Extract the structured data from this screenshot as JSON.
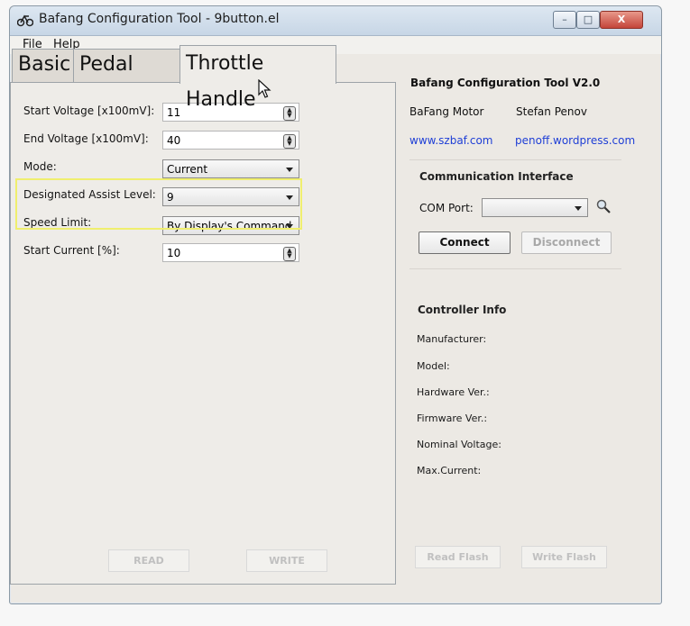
{
  "window": {
    "title": "Bafang Configuration Tool - 9button.el",
    "controls": [
      "–",
      "□",
      "X"
    ]
  },
  "menu": [
    "File",
    "Help"
  ],
  "tabs": [
    {
      "label": "Basic"
    },
    {
      "label": "Pedal Assit"
    },
    {
      "label": "Throttle Handle",
      "selected": true
    }
  ],
  "throttle": {
    "fields": [
      {
        "label": "Start Voltage [x100mV]:",
        "value": "11"
      },
      {
        "label": "End Voltage [x100mV]:",
        "value": "40"
      },
      {
        "label": "Mode:",
        "value": "Current"
      },
      {
        "label": "Designated Assist Level:",
        "value": "9"
      },
      {
        "label": "Speed Limit:",
        "value": "By Display's Command"
      },
      {
        "label": "Start Current [%]:",
        "value": "10"
      }
    ],
    "read_button": "READ",
    "write_button": "WRITE"
  },
  "about": {
    "title": "Bafang Configuration Tool V2.0",
    "vendor": "BaFang Motor",
    "author": "Stefan Penov",
    "vendor_link": "www.szbaf.com",
    "author_link": "penoff.wordpress.com"
  },
  "comm": {
    "title": "Communication Interface",
    "com_port_label": "COM Port:",
    "connect": "Connect",
    "disconnect": "Disconnect"
  },
  "controller": {
    "title": "Controller Info",
    "labels": [
      "Manufacturer:",
      "Model:",
      "Hardware Ver.:",
      "Firmware Ver.:",
      "Nominal Voltage:",
      "Max.Current:"
    ]
  },
  "flash": {
    "read": "Read Flash",
    "write": "Write Flash"
  },
  "colors": {
    "link": "#1f3fd6",
    "highlight": "#f0ef6e"
  }
}
